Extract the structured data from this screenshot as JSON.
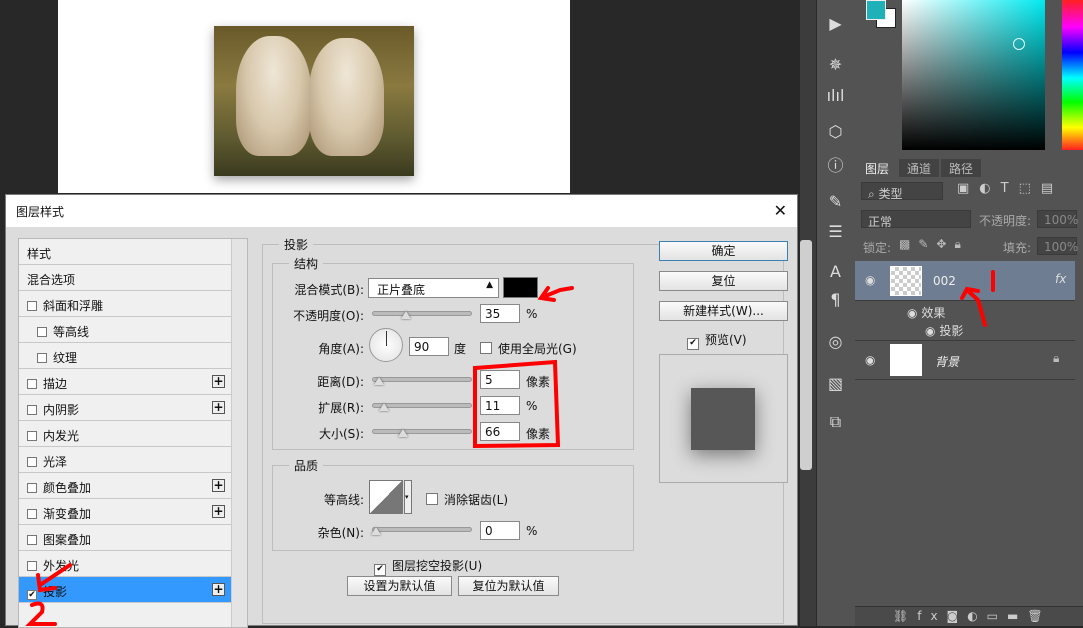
{
  "dialog": {
    "title": "图层样式",
    "style_list": [
      {
        "label": "样式",
        "checkbox": false,
        "checked": false,
        "plus": false,
        "indent": false
      },
      {
        "label": "混合选项",
        "checkbox": false,
        "checked": false,
        "plus": false,
        "indent": false
      },
      {
        "label": "斜面和浮雕",
        "checkbox": true,
        "checked": false,
        "plus": false,
        "indent": false
      },
      {
        "label": "等高线",
        "checkbox": true,
        "checked": false,
        "plus": false,
        "indent": true
      },
      {
        "label": "纹理",
        "checkbox": true,
        "checked": false,
        "plus": false,
        "indent": true
      },
      {
        "label": "描边",
        "checkbox": true,
        "checked": false,
        "plus": true,
        "indent": false
      },
      {
        "label": "内阴影",
        "checkbox": true,
        "checked": false,
        "plus": true,
        "indent": false
      },
      {
        "label": "内发光",
        "checkbox": true,
        "checked": false,
        "plus": false,
        "indent": false
      },
      {
        "label": "光泽",
        "checkbox": true,
        "checked": false,
        "plus": false,
        "indent": false
      },
      {
        "label": "颜色叠加",
        "checkbox": true,
        "checked": false,
        "plus": true,
        "indent": false
      },
      {
        "label": "渐变叠加",
        "checkbox": true,
        "checked": false,
        "plus": true,
        "indent": false
      },
      {
        "label": "图案叠加",
        "checkbox": true,
        "checked": false,
        "plus": false,
        "indent": false
      },
      {
        "label": "外发光",
        "checkbox": true,
        "checked": false,
        "plus": false,
        "indent": false
      },
      {
        "label": "投影",
        "checkbox": true,
        "checked": true,
        "plus": true,
        "indent": false,
        "selected": true
      }
    ],
    "section_title": "投影",
    "structure": {
      "title": "结构",
      "blend_mode_label": "混合模式(B):",
      "blend_mode_value": "正片叠底",
      "shadow_color": "#000000",
      "opacity_label": "不透明度(O):",
      "opacity_value": "35",
      "opacity_unit": "%",
      "angle_label": "角度(A):",
      "angle_value": "90",
      "angle_unit": "度",
      "global_light_label": "使用全局光(G)",
      "global_light_checked": false,
      "distance_label": "距离(D):",
      "distance_value": "5",
      "distance_unit": "像素",
      "spread_label": "扩展(R):",
      "spread_value": "11",
      "spread_unit": "%",
      "size_label": "大小(S):",
      "size_value": "66",
      "size_unit": "像素"
    },
    "quality": {
      "title": "品质",
      "contour_label": "等高线:",
      "anti_alias_label": "消除锯齿(L)",
      "anti_alias_checked": false,
      "noise_label": "杂色(N):",
      "noise_value": "0",
      "noise_unit": "%"
    },
    "knockout_label": "图层挖空投影(U)",
    "knockout_checked": true,
    "set_default_label": "设置为默认值",
    "reset_default_label": "复位为默认值",
    "buttons": {
      "ok": "确定",
      "reset": "复位",
      "new_style": "新建样式(W)..."
    },
    "preview_label": "预览(V)",
    "preview_checked": true
  },
  "color_panel": {
    "foreground": "#20b0b8",
    "background": "#ffffff"
  },
  "layers_panel": {
    "tabs": [
      "图层",
      "通道",
      "路径"
    ],
    "filter_label": "类型",
    "blend_mode": "正常",
    "opacity_label": "不透明度:",
    "opacity_value": "100%",
    "lock_label": "锁定:",
    "fill_label": "填充:",
    "fill_value": "100%",
    "layers": [
      {
        "name": "002",
        "fx": "fx",
        "selected": true,
        "effects_label": "效果",
        "effect_items": [
          "投影"
        ]
      },
      {
        "name": "背景",
        "locked": true
      }
    ]
  },
  "annotations": {
    "color": "#ff0000",
    "labels": [
      "1",
      "2"
    ]
  }
}
